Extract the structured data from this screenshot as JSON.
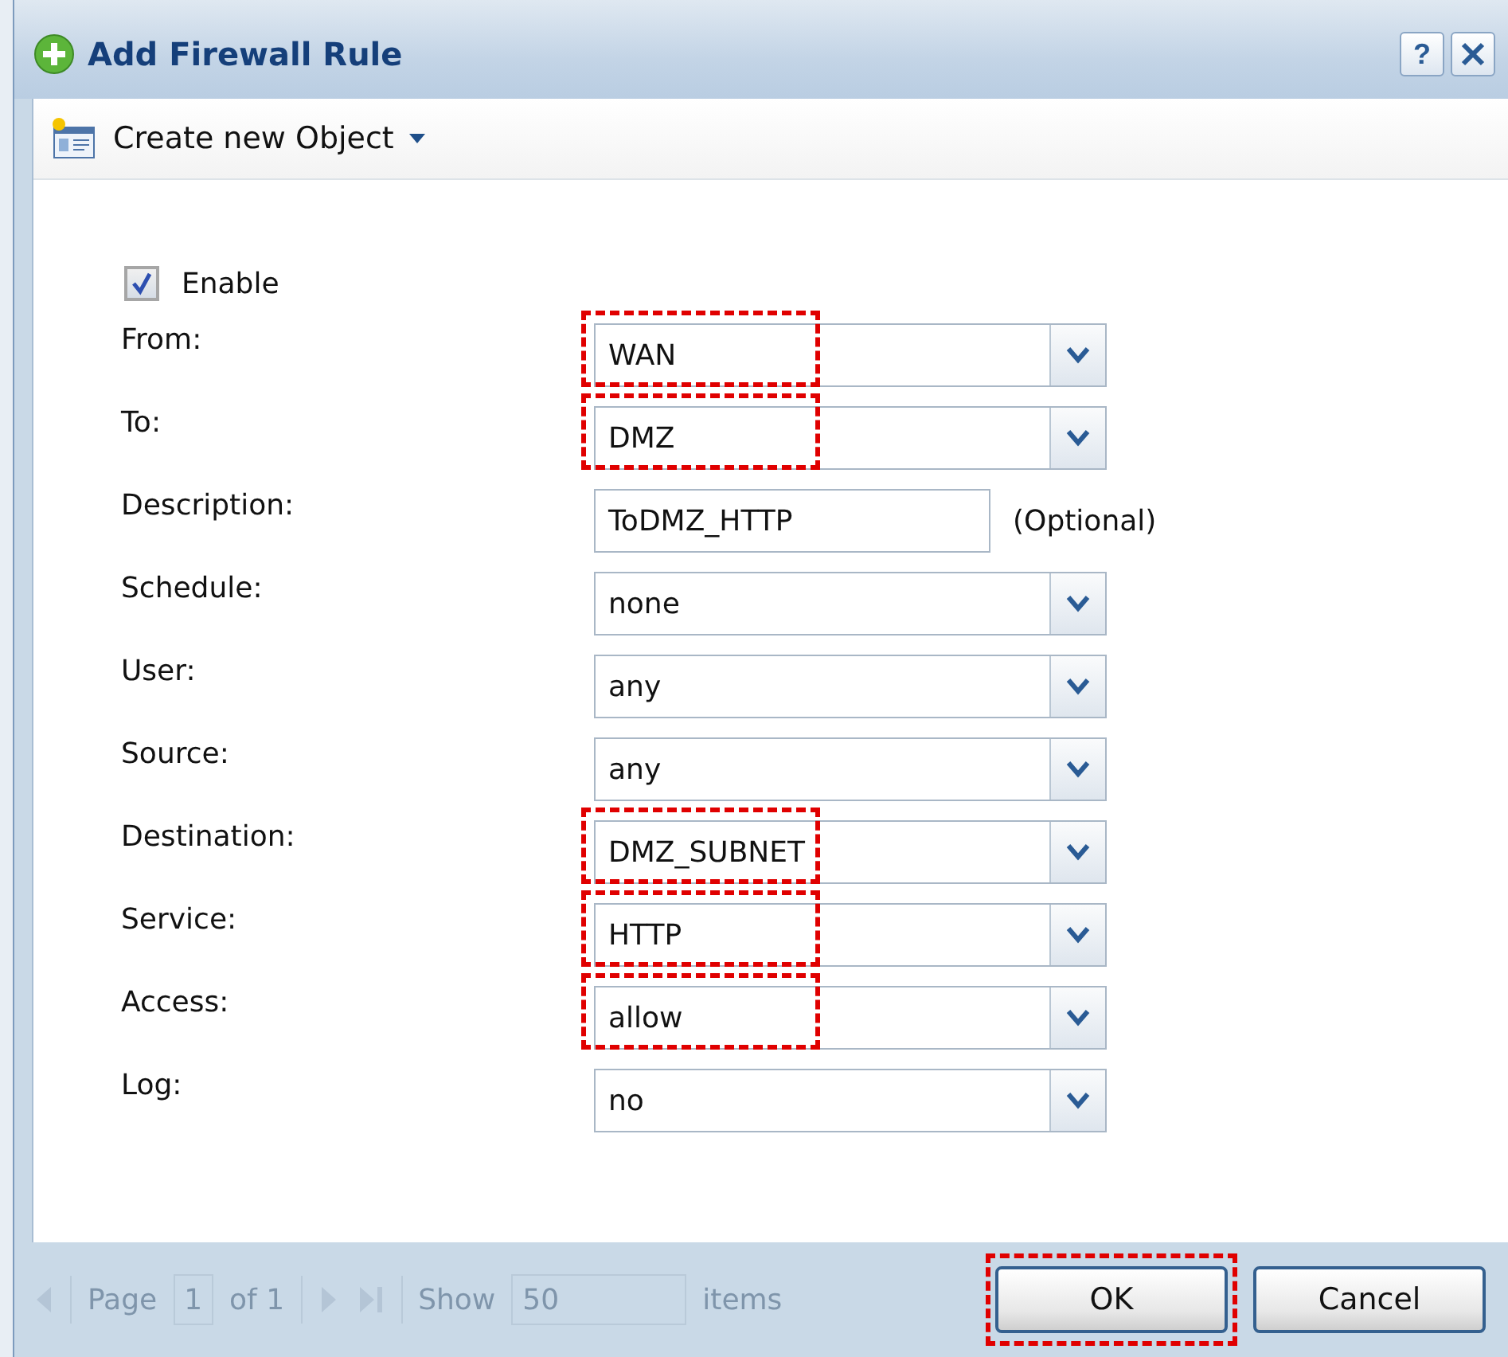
{
  "dialog": {
    "title": "Add Firewall Rule",
    "help_button": "?"
  },
  "toolbar": {
    "create_menu": "Create new Object"
  },
  "enable": {
    "label": "Enable",
    "checked": true
  },
  "fields": [
    {
      "kind": "select",
      "label": "From:",
      "value": "WAN",
      "highlighted": true
    },
    {
      "kind": "select",
      "label": "To:",
      "value": "DMZ",
      "highlighted": true
    },
    {
      "kind": "text",
      "label": "Description:",
      "value": "ToDMZ_HTTP",
      "note": "(Optional)",
      "highlighted": false
    },
    {
      "kind": "select",
      "label": "Schedule:",
      "value": "none",
      "highlighted": false
    },
    {
      "kind": "select",
      "label": "User:",
      "value": "any",
      "highlighted": false
    },
    {
      "kind": "select",
      "label": "Source:",
      "value": "any",
      "highlighted": false
    },
    {
      "kind": "select",
      "label": "Destination:",
      "value": "DMZ_SUBNET",
      "highlighted": true
    },
    {
      "kind": "select",
      "label": "Service:",
      "value": "HTTP",
      "highlighted": true
    },
    {
      "kind": "select",
      "label": "Access:",
      "value": "allow",
      "highlighted": true
    },
    {
      "kind": "select",
      "label": "Log:",
      "value": "no",
      "highlighted": false
    }
  ],
  "pager": {
    "page_label": "Page",
    "page": "1",
    "of_label": "of 1",
    "show_label": "Show",
    "show": "50",
    "items_label": "items"
  },
  "buttons": [
    {
      "label": "OK",
      "highlighted": true
    },
    {
      "label": "Cancel",
      "highlighted": false
    }
  ]
}
